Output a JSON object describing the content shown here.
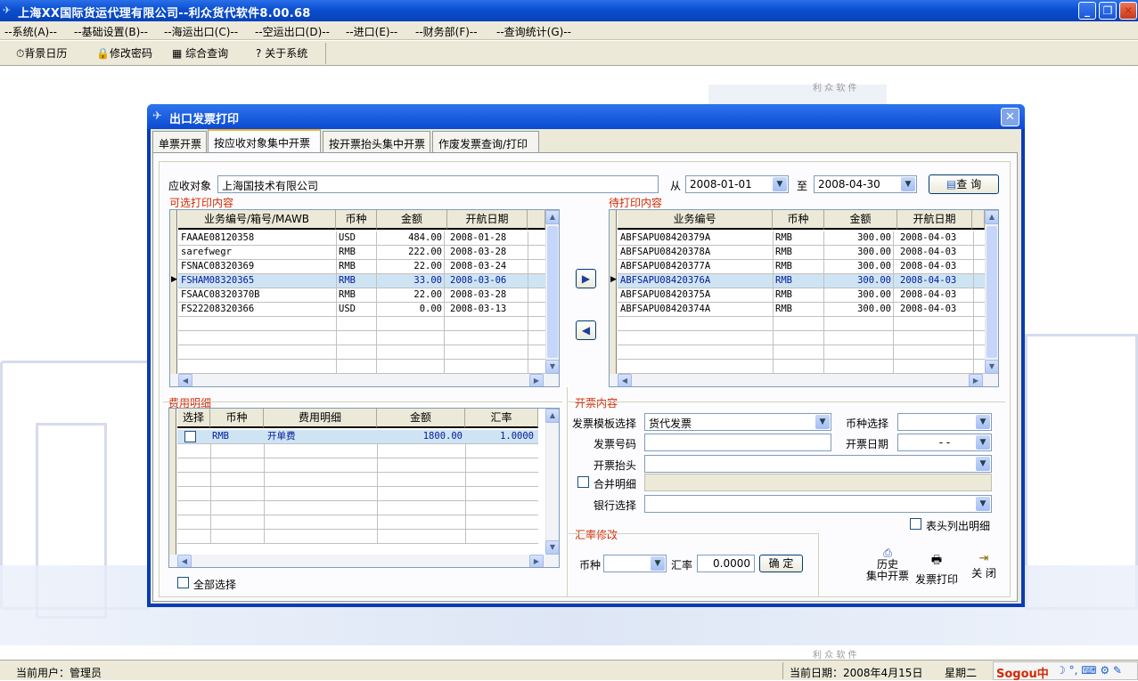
{
  "app": {
    "title": "上海XX国际货运代理有限公司--利众货代软件8.00.68",
    "icon": "app-plane-icon"
  },
  "menu": [
    "--系统(A)--",
    "--基础设置(B)--",
    "--海运出口(C)--",
    "--空运出口(D)--",
    "--进口(E)--",
    "--财务部(F)--",
    "--查询统计(G)--"
  ],
  "toolbar": [
    {
      "icon": "clock-icon",
      "label": "背景日历"
    },
    {
      "icon": "lock-icon",
      "label": "修改密码"
    },
    {
      "icon": "table-icon",
      "label": "综合查询"
    },
    {
      "icon": "question-icon",
      "label": "关于系统"
    }
  ],
  "watermark": "利 众 软 件",
  "dialog": {
    "title": "出口发票打印",
    "tabs": [
      "单票开票",
      "按应收对象集中开票",
      "按开票抬头集中开票",
      "作废发票查询/打印"
    ],
    "filter": {
      "label": "应收对象",
      "value": "上海国技术有限公司",
      "from_label": "从",
      "from": "2008-01-01",
      "to_label": "至",
      "to": "2008-04-30",
      "query": "查 询"
    },
    "left": {
      "title": "可选打印内容",
      "headers": [
        "业务编号/箱号/MAWB",
        "币种",
        "金额",
        "开航日期"
      ],
      "rows": [
        [
          "FAAAE08120358",
          "USD",
          "484.00",
          "2008-01-28"
        ],
        [
          "sarefwegr",
          "RMB",
          "222.00",
          "2008-03-28"
        ],
        [
          "FSNAC08320369",
          "RMB",
          "22.00",
          "2008-03-24"
        ],
        [
          "FSHAM08320365",
          "RMB",
          "33.00",
          "2008-03-06"
        ],
        [
          "FSAAC08320370B",
          "RMB",
          "22.00",
          "2008-03-28"
        ],
        [
          "FS22208320366",
          "USD",
          "0.00",
          "2008-03-13"
        ]
      ]
    },
    "right": {
      "title": "待打印内容",
      "headers": [
        "业务编号",
        "币种",
        "金额",
        "开航日期"
      ],
      "rows": [
        [
          "ABFSAPU08420379A",
          "RMB",
          "300.00",
          "2008-04-03"
        ],
        [
          "ABFSAPU08420378A",
          "RMB",
          "300.00",
          "2008-04-03"
        ],
        [
          "ABFSAPU08420377A",
          "RMB",
          "300.00",
          "2008-04-03"
        ],
        [
          "ABFSAPU08420376A",
          "RMB",
          "300.00",
          "2008-04-03"
        ],
        [
          "ABFSAPU08420375A",
          "RMB",
          "300.00",
          "2008-04-03"
        ],
        [
          "ABFSAPU08420374A",
          "RMB",
          "300.00",
          "2008-04-03"
        ]
      ]
    },
    "fees": {
      "title": "费用明细",
      "headers": [
        "选择",
        "币种",
        "费用明细",
        "金额",
        "汇率"
      ],
      "rows": [
        [
          "",
          "RMB",
          "开单费",
          "1800.00",
          "1.0000"
        ]
      ],
      "select_all": "全部选择"
    },
    "invoice": {
      "title": "开票内容",
      "template_label": "发票模板选择",
      "template": "货代发票",
      "currency_label": "币种选择",
      "currency": "",
      "no_label": "发票号码",
      "no": "",
      "date_label": "开票日期",
      "date": "-  -",
      "header_label": "开票抬头",
      "header": "",
      "merge_label": "合并明细",
      "bank_label": "银行选择",
      "bank": "",
      "detail_label": "表头列出明细"
    },
    "rate": {
      "title": "汇率修改",
      "currency_label": "币种",
      "currency": "",
      "rate_label": "汇率",
      "rate": "0.0000",
      "confirm": "确 定"
    },
    "actions": [
      {
        "icon": "history-icon",
        "label": "历史\n集中开票"
      },
      {
        "icon": "printer-icon",
        "label": "发票打印"
      },
      {
        "icon": "exit-icon",
        "label": "关 闭"
      }
    ]
  },
  "status": {
    "user": "当前用户：管理员",
    "date": "当前日期：2008年4月15日",
    "weekday": "星期二",
    "ime": "Sogou中"
  }
}
